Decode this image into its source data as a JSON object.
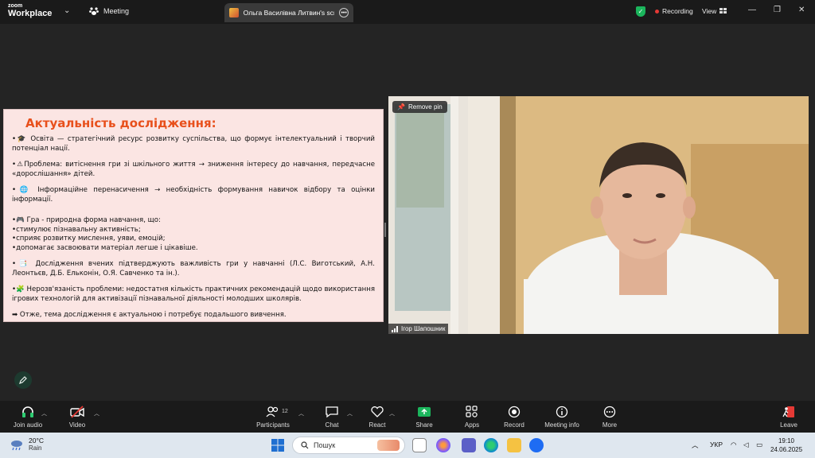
{
  "app": {
    "logo_small": "zoom",
    "logo_big": "Workplace",
    "meeting_label": "Meeting",
    "share_tab_label": "Ольга Василівна Литвин's scree",
    "recording_label": "Recording",
    "view_label": "View"
  },
  "slide": {
    "title": "Актуальність дослідження:",
    "p1": "•🎓 Освіта — стратегічний ресурс розвитку суспільства, що формує інтелектуальний і творчий потенціал нації.",
    "p2": "•⚠Проблема: витіснення гри зі шкільного життя → зниження інтересу до навчання, передчасне «дорослішання» дітей.",
    "p3": "•🌐 Інформаційне перенасичення → необхідність формування навичок відбору та оцінки інформації.",
    "p4": "•🎮 Гра - природна форма навчання, що:",
    "p5": "•стимулює пізнавальну активність;",
    "p6": "•сприяє розвитку мислення, уяви, емоцій;",
    "p7": "•допомагає засвоювати матеріал легше і цікавіше.",
    "p8": "•📑 Дослідження вчених підтверджують важливість гри у навчанні (Л.С. Виготський, А.Н. Леонтьєв, Д.Б. Ельконін, О.Я. Савченко та ін.).",
    "p9": "•🧩 Нерозв'язаність проблеми: недостатня кількість практичних рекомендацій щодо використання ігрових технологій для активізації пізнавальної діяльності молодших школярів.",
    "p10": "➡ Отже, тема дослідження є актуальною і потребує подальшого вивчення."
  },
  "video": {
    "pin_label": "Remove pin",
    "participant_name": "Ігор Шапошник"
  },
  "toolbar": {
    "join_audio": "Join audio",
    "video": "Video",
    "participants": "Participants",
    "participants_count": "12",
    "chat": "Chat",
    "react": "React",
    "share": "Share",
    "apps": "Apps",
    "record": "Record",
    "meeting_info": "Meeting info",
    "more": "More",
    "leave": "Leave"
  },
  "taskbar": {
    "temperature": "20°C",
    "weather": "Rain",
    "search_placeholder": "Пошук",
    "language": "УКР",
    "time": "19:10",
    "date": "24.06.2025"
  },
  "colors": {
    "slide_title": "#e8501c",
    "slide_bg": "#fbe5e3",
    "share_green": "#1bb55c",
    "recording_red": "#e53935"
  }
}
